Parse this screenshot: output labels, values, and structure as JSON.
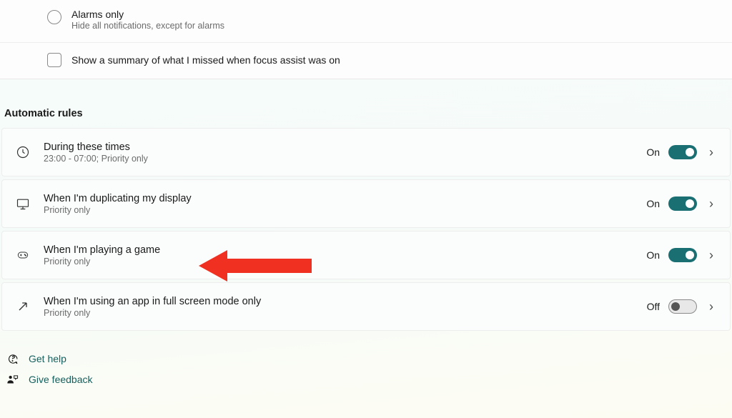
{
  "focusAssist": {
    "alarms": {
      "title": "Alarms only",
      "desc": "Hide all notifications, except for alarms"
    },
    "summaryCheckbox": "Show a summary of what I missed when focus assist was on"
  },
  "automaticRules": {
    "header": "Automatic rules",
    "items": [
      {
        "title": "During these times",
        "sub": "23:00 - 07:00; Priority only",
        "stateLabel": "On",
        "on": true
      },
      {
        "title": "When I'm duplicating my display",
        "sub": "Priority only",
        "stateLabel": "On",
        "on": true
      },
      {
        "title": "When I'm playing a game",
        "sub": "Priority only",
        "stateLabel": "On",
        "on": true
      },
      {
        "title": "When I'm using an app in full screen mode only",
        "sub": "Priority only",
        "stateLabel": "Off",
        "on": false
      }
    ]
  },
  "footer": {
    "help": "Get help",
    "feedback": "Give feedback"
  }
}
